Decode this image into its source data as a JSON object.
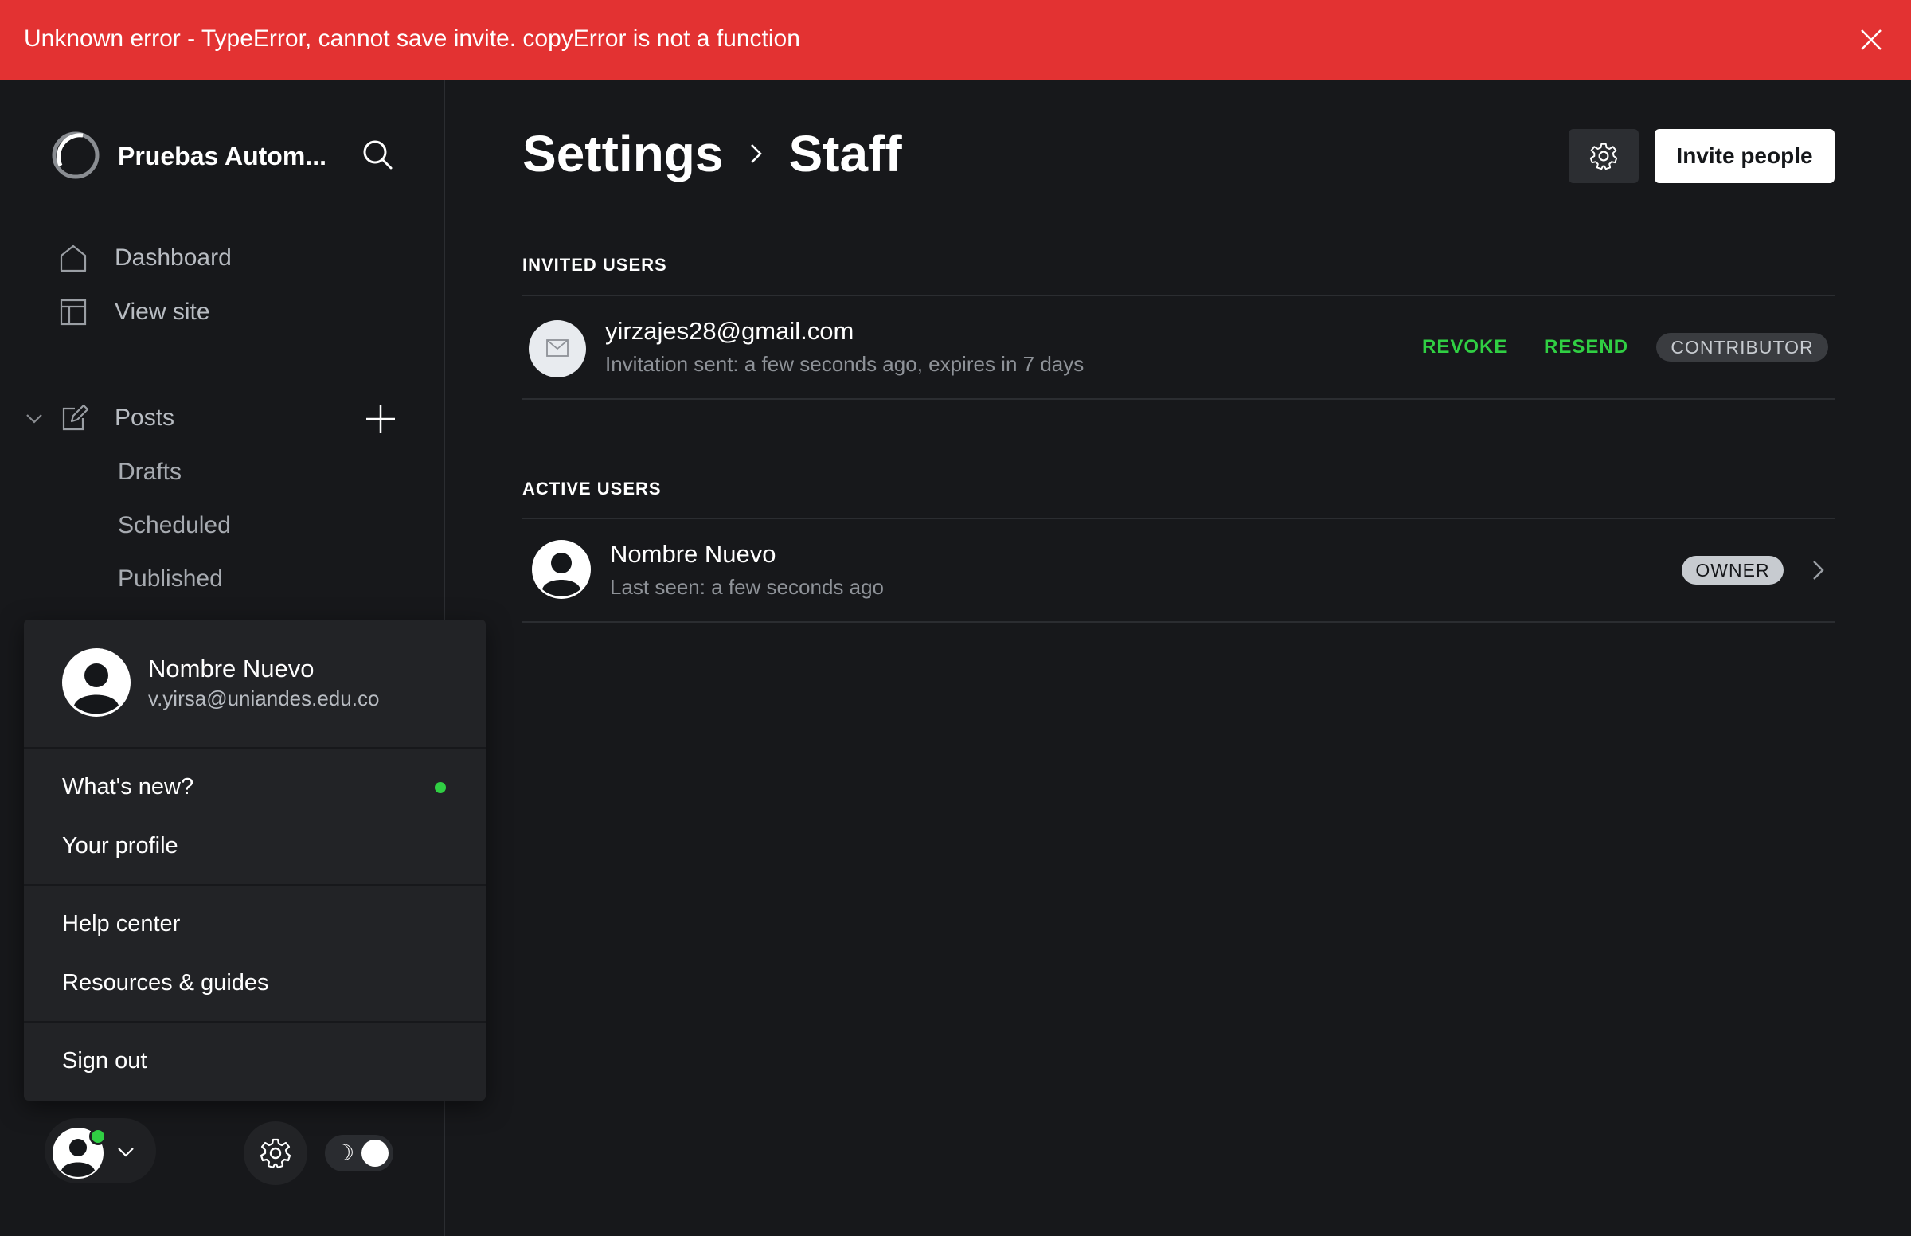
{
  "banner": {
    "message": "Unknown error - TypeError, cannot save invite. copyError is not a function",
    "close_icon": "close-icon"
  },
  "colors": {
    "banner_bg": "#e33232",
    "accent_green": "#30cf43",
    "background": "#17181b",
    "menu_bg": "#222326"
  },
  "sidebar": {
    "site_title": "Pruebas Autom...",
    "nav": {
      "dashboard": "Dashboard",
      "view_site": "View site",
      "posts": "Posts"
    },
    "posts_sub": {
      "drafts": "Drafts",
      "scheduled": "Scheduled",
      "published": "Published"
    }
  },
  "user_menu": {
    "name": "Nombre Nuevo",
    "email": "v.yirsa@uniandes.edu.co",
    "whats_new": "What's new?",
    "your_profile": "Your profile",
    "help_center": "Help center",
    "resources": "Resources & guides",
    "sign_out": "Sign out"
  },
  "bottom_bar": {
    "theme_toggle_icon": "☽"
  },
  "header": {
    "crumb_parent": "Settings",
    "crumb_current": "Staff",
    "invite_button": "Invite people"
  },
  "invited": {
    "section_title": "INVITED USERS",
    "email": "yirzajes28@gmail.com",
    "status": "Invitation sent: a few seconds ago, expires in 7 days",
    "revoke": "REVOKE",
    "resend": "RESEND",
    "role": "CONTRIBUTOR"
  },
  "active": {
    "section_title": "ACTIVE USERS",
    "name": "Nombre Nuevo",
    "last_seen": "Last seen: a few seconds ago",
    "role": "OWNER"
  }
}
